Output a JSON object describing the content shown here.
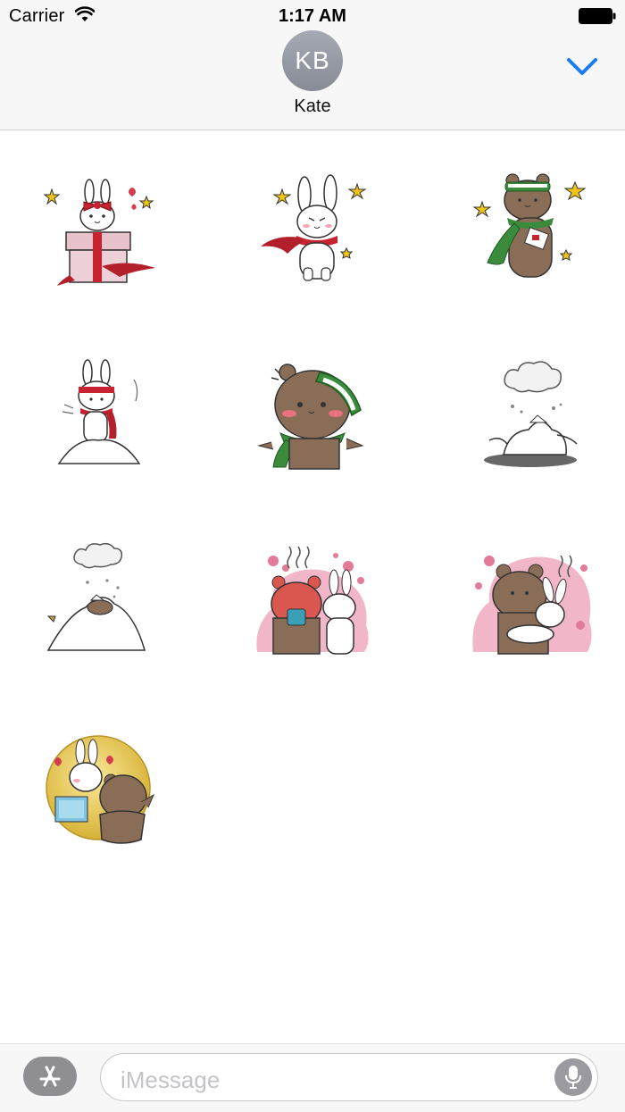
{
  "status_bar": {
    "carrier": "Carrier",
    "time": "1:17 AM",
    "wifi_icon": "wifi-icon",
    "battery_icon": "battery-full-icon"
  },
  "header": {
    "avatar_initials": "KB",
    "contact_name": "Kate",
    "collapse_icon": "chevron-down-icon",
    "accent_color": "#1a7cf5"
  },
  "stickers": [
    {
      "subject": "bunny in gift box with red bow"
    },
    {
      "subject": "bunny with red scarf and stars"
    },
    {
      "subject": "bear with green scarf and stars"
    },
    {
      "subject": "bunny with headband in snow"
    },
    {
      "subject": "bear with green hat and scarf"
    },
    {
      "subject": "bunny lying in snow with cloud"
    },
    {
      "subject": "bear buried in snow pile"
    },
    {
      "subject": "bear and bunny with hot drink"
    },
    {
      "subject": "bear hugging bunny"
    },
    {
      "subject": "bunny and bear circle badge"
    }
  ],
  "input_bar": {
    "app_store_icon": "app-store-icon",
    "placeholder": "iMessage",
    "mic_icon": "microphone-icon"
  }
}
